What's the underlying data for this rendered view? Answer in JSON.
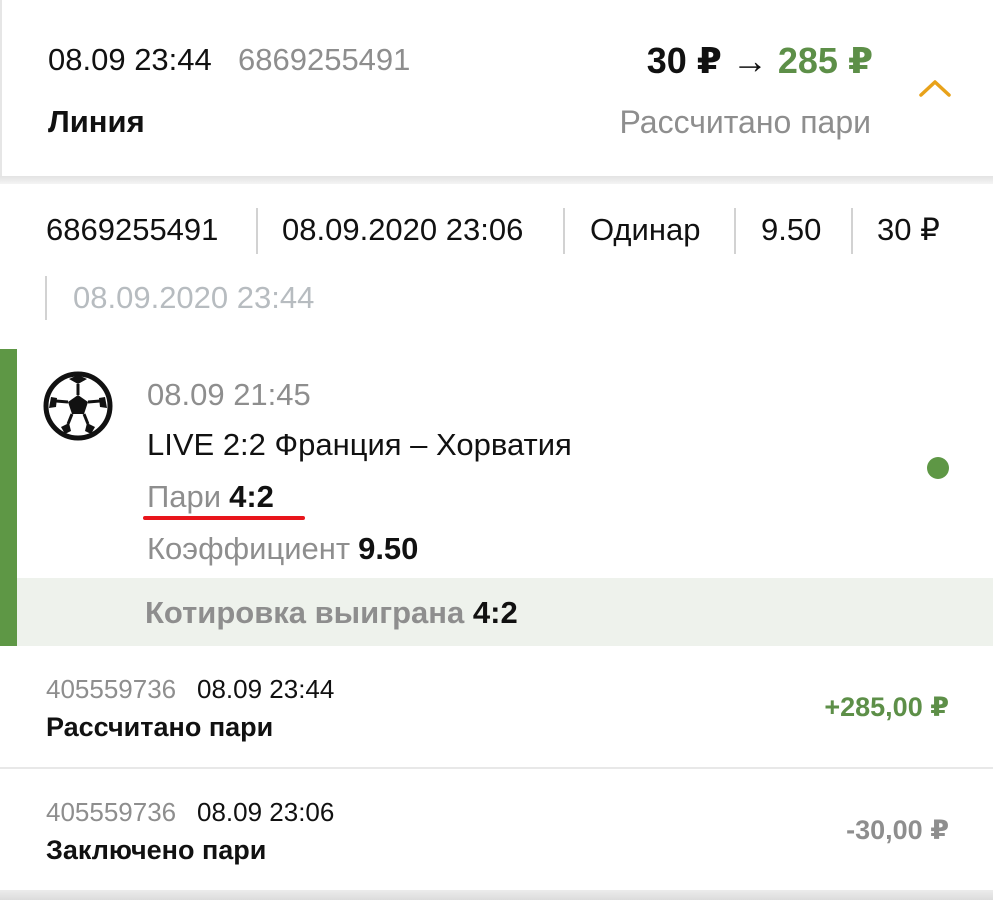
{
  "header": {
    "date": "08.09 23:44",
    "bet_id": "6869255491",
    "type": "Линия",
    "stake": "30 ₽",
    "arrow": "→",
    "payout": "285 ₽",
    "status": "Рассчитано пари",
    "collapse_icon": "chevron-up-icon"
  },
  "info": {
    "bet_id": "6869255491",
    "created": "08.09.2020 23:06",
    "bet_kind": "Одинар",
    "odds": "9.50",
    "stake": "30 ₽",
    "settled": "08.09.2020 23:44"
  },
  "event": {
    "sport_icon": "soccer-ball-icon",
    "time": "08.09 21:45",
    "title": "LIVE 2:2 Франция – Хорватия",
    "pick_label": "Пари",
    "pick_value": "4:2",
    "coef_label": "Коэффициент",
    "coef_value": "9.50",
    "result_label": "Котировка выиграна",
    "result_value": "4:2"
  },
  "transactions": [
    {
      "id": "405559736",
      "time": "08.09 23:44",
      "title": "Рассчитано пари",
      "amount": "+285,00 ₽"
    },
    {
      "id": "405559736",
      "time": "08.09 23:06",
      "title": "Заключено пари",
      "amount": "-30,00 ₽"
    }
  ],
  "colors": {
    "win": "#5d8f48",
    "accent_chevron": "#e8a21a",
    "event_bar": "#5e9745",
    "underline": "#e8151b",
    "muted": "#8e8e8e"
  }
}
